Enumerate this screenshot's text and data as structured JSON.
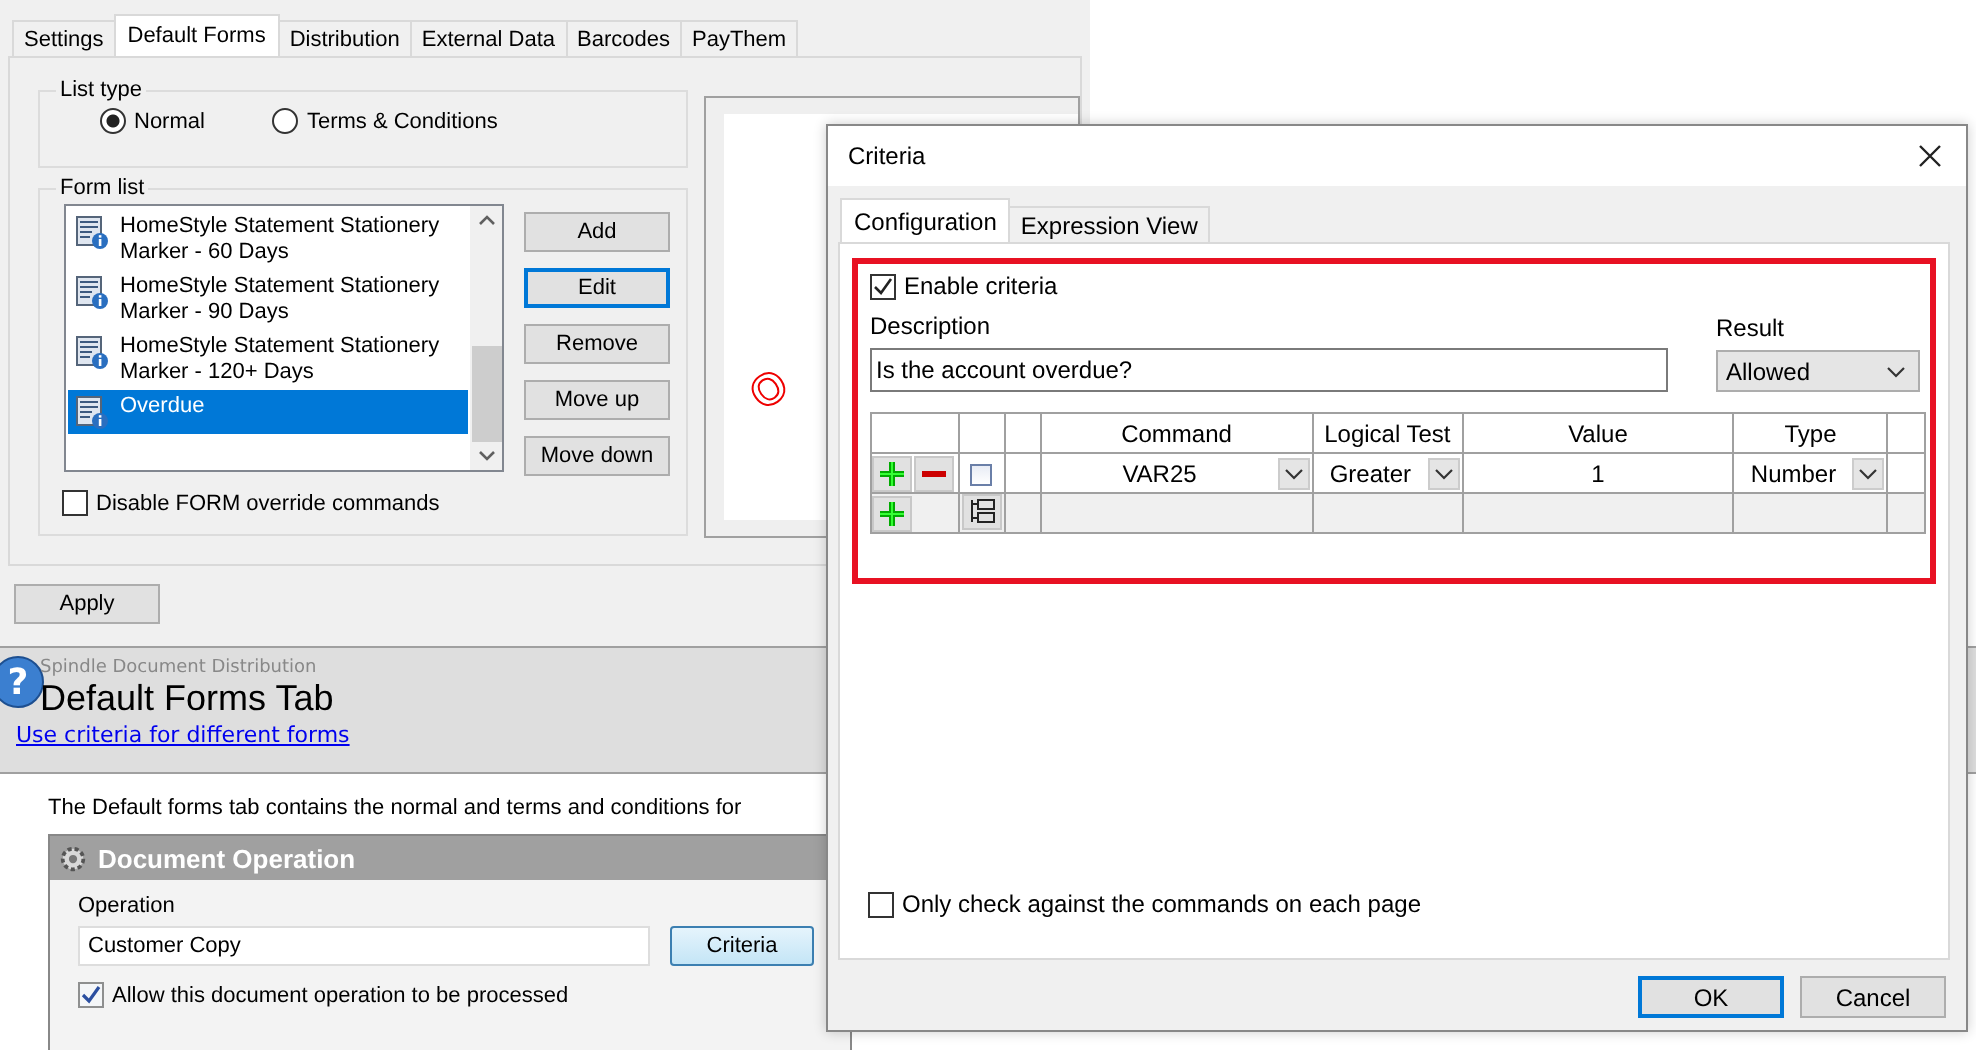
{
  "settings": {
    "tabs": [
      {
        "label": "Settings",
        "selected": false
      },
      {
        "label": "Default Forms",
        "selected": true
      },
      {
        "label": "Distribution",
        "selected": false
      },
      {
        "label": "External Data",
        "selected": false
      },
      {
        "label": "Barcodes",
        "selected": false
      },
      {
        "label": "PayThem",
        "selected": false
      }
    ],
    "list_type": {
      "legend": "List type",
      "options": [
        {
          "label": "Normal",
          "selected": true
        },
        {
          "label": "Terms & Conditions",
          "selected": false
        }
      ]
    },
    "form_list": {
      "legend": "Form list",
      "items": [
        {
          "lines": [
            "HomeStyle Statement Stationery",
            "Marker - 60 Days"
          ],
          "selected": false
        },
        {
          "lines": [
            "HomeStyle Statement Stationery",
            "Marker - 90 Days"
          ],
          "selected": false
        },
        {
          "lines": [
            "HomeStyle Statement Stationery",
            "Marker - 120+ Days"
          ],
          "selected": false
        },
        {
          "lines": [
            "Overdue"
          ],
          "selected": true
        }
      ],
      "buttons": [
        {
          "label": "Add",
          "focused": false
        },
        {
          "label": "Edit",
          "focused": true
        },
        {
          "label": "Remove",
          "focused": false
        },
        {
          "label": "Move up",
          "focused": false
        },
        {
          "label": "Move down",
          "focused": false
        }
      ],
      "disable_override": {
        "label": "Disable FORM override commands",
        "checked": false
      }
    },
    "preview_text": "O",
    "apply": "Apply"
  },
  "help": {
    "icon": "?",
    "app_name": "Spindle Document Distribution",
    "title": "Default Forms Tab",
    "link": "Use criteria for different forms",
    "paragraph": "The Default forms tab contains the normal and terms and conditions for",
    "operation_box": {
      "title": "Document Operation",
      "field_label": "Operation",
      "field_value": "Customer Copy",
      "button": "Criteria",
      "allow": {
        "label": "Allow this document operation to be processed",
        "checked": true
      }
    }
  },
  "dialog": {
    "title": "Criteria",
    "tabs": [
      {
        "label": "Configuration",
        "selected": true
      },
      {
        "label": "Expression View",
        "selected": false
      }
    ],
    "enable": {
      "label": "Enable criteria",
      "checked": true
    },
    "description_label": "Description",
    "description_value": "Is the account overdue?",
    "result_label": "Result",
    "result_value": "Allowed",
    "grid": {
      "columns": [
        "Command",
        "Logical Test",
        "Value",
        "Type"
      ],
      "rows": [
        {
          "kind": "condition",
          "checked": false,
          "command": "VAR25",
          "test": "Greater",
          "value": "1",
          "type": "Number"
        },
        {
          "kind": "add"
        }
      ]
    },
    "only_check": {
      "label": "Only check against the commands on each page",
      "checked": false
    },
    "buttons": [
      {
        "label": "OK",
        "focused": true
      },
      {
        "label": "Cancel",
        "focused": false
      }
    ]
  }
}
